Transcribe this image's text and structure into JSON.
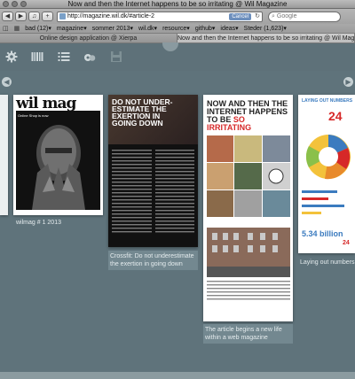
{
  "window": {
    "title": "Now and then the Internet happens to be so irritating @ Wil Magazine"
  },
  "toolbar": {
    "back_label": "◀",
    "forward_label": "▶",
    "bookmark_label": "♫",
    "add_label": "+",
    "url": "http://magazine.wil.dk/#article-2",
    "cancel_label": "Cancel",
    "search_placeholder": "Google"
  },
  "bookmarks": [
    {
      "label": "bad (12)▾"
    },
    {
      "label": "magazine▾"
    },
    {
      "label": "sommer 2013▾"
    },
    {
      "label": "wil.dk▾"
    },
    {
      "label": "resource▾"
    },
    {
      "label": "github▾"
    },
    {
      "label": "ideas▾"
    },
    {
      "label": "Steder (1,623)▾"
    }
  ],
  "tabs": [
    {
      "label": "Online design application @ Xierpa"
    },
    {
      "label": "Now and then the Internet happens to be so irritating @ Wil Magazine"
    }
  ],
  "carousel": {
    "items": [
      {
        "caption": "wilmag # 1 2013",
        "cover": {
          "logo": "wil mag",
          "side": "Online Shop is now"
        }
      },
      {
        "caption": "Crossfit: Do not underestimate the exertion in going down",
        "cover": {
          "headline": "DO NOT UNDER-ESTIMATE THE EXERTION IN GOING DOWN"
        }
      },
      {
        "caption": "The article begins a new life within a web magazine",
        "cover": {
          "headline_a": "NOW AND THEN THE INTERNET HAPPENS TO BE",
          "headline_b": "SO",
          "headline_c": "IRRITATING"
        }
      },
      {
        "caption": "Laying out numbers",
        "cover": {
          "headline": "LAYING OUT NUMBERS",
          "stat": "24",
          "big": "5.34 billion",
          "small": "24"
        }
      }
    ]
  },
  "colors": {
    "accent_red": "#d62828",
    "bg": "#5f737b"
  }
}
